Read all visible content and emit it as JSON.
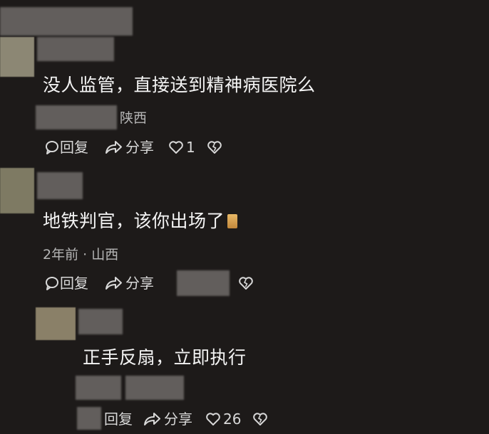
{
  "comments": [
    {
      "text": "没人监管，直接送到精神病医院么",
      "location": "陕西",
      "reply_label": "回复",
      "share_label": "分享",
      "like_count": "1"
    },
    {
      "text": "地铁判官，该你出场了",
      "meta": "2年前 · 山西",
      "reply_label": "回复",
      "share_label": "分享"
    },
    {
      "text": "正手反扇，立即执行",
      "reply_label": "回复",
      "share_label": "分享",
      "like_count": "26"
    }
  ],
  "icons": {
    "reply": "comment-bubble-icon",
    "share": "share-arrow-icon",
    "like": "heart-icon",
    "dislike": "broken-heart-icon"
  },
  "colors": {
    "background": "#1d1a19",
    "text": "#f4f4f4",
    "meta": "#b5b5b5"
  }
}
